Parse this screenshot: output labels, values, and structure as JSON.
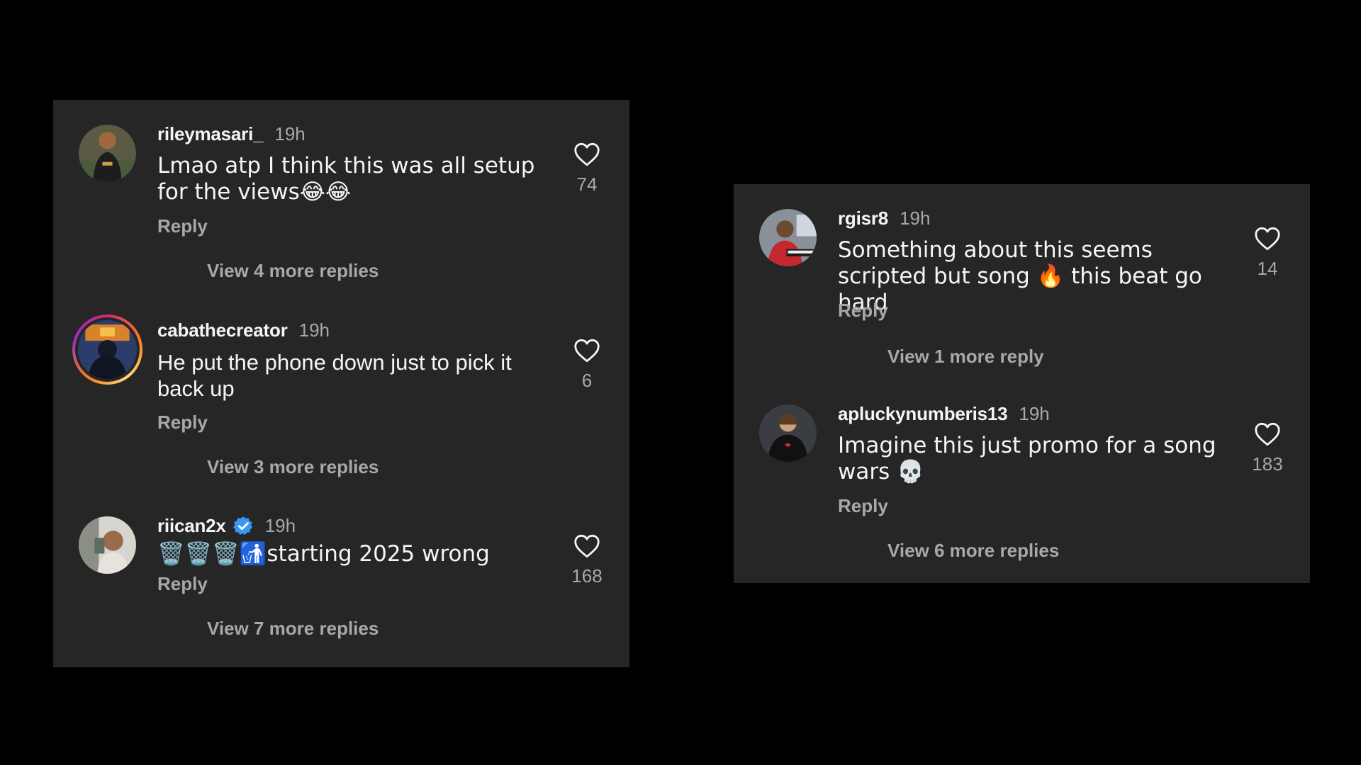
{
  "left_panel": {
    "comments": [
      {
        "username": "rileymasari_",
        "time": "19h",
        "text": "Lmao atp I think this was all setup for the views😂😂",
        "reply": "Reply",
        "view_more": "View 4 more replies",
        "likes": "74",
        "verified": false,
        "story_ring": false
      },
      {
        "username": "cabathecreator",
        "time": "19h",
        "text": "He put the phone down just to pick it back up",
        "reply": "Reply",
        "view_more": "View 3 more replies",
        "likes": "6",
        "verified": false,
        "story_ring": true
      },
      {
        "username": "riican2x",
        "time": "19h",
        "text": "🗑️🗑️🗑️🚮starting 2025 wrong",
        "reply": "Reply",
        "view_more": "View 7 more replies",
        "likes": "168",
        "verified": true,
        "story_ring": false
      }
    ]
  },
  "right_panel": {
    "comments": [
      {
        "username": "rgisr8",
        "time": "19h",
        "text": "Something about this seems scripted but song 🔥 this beat go hard",
        "reply": "Reply",
        "view_more": "View 1 more reply",
        "likes": "14",
        "verified": false,
        "story_ring": false
      },
      {
        "username": "apluckynumberis13",
        "time": "19h",
        "text": "Imagine this just promo for a song wars 💀",
        "reply": "Reply",
        "view_more": "View 6 more replies",
        "likes": "183",
        "verified": false,
        "story_ring": false
      }
    ]
  },
  "icons": {
    "like": "heart-outline-icon",
    "verified": "verified-badge-icon"
  },
  "colors": {
    "background": "#000000",
    "panel": "#262626",
    "primary_text": "#f5f5f5",
    "secondary_text": "#a8a8a8",
    "verified_blue": "#3897f0"
  }
}
